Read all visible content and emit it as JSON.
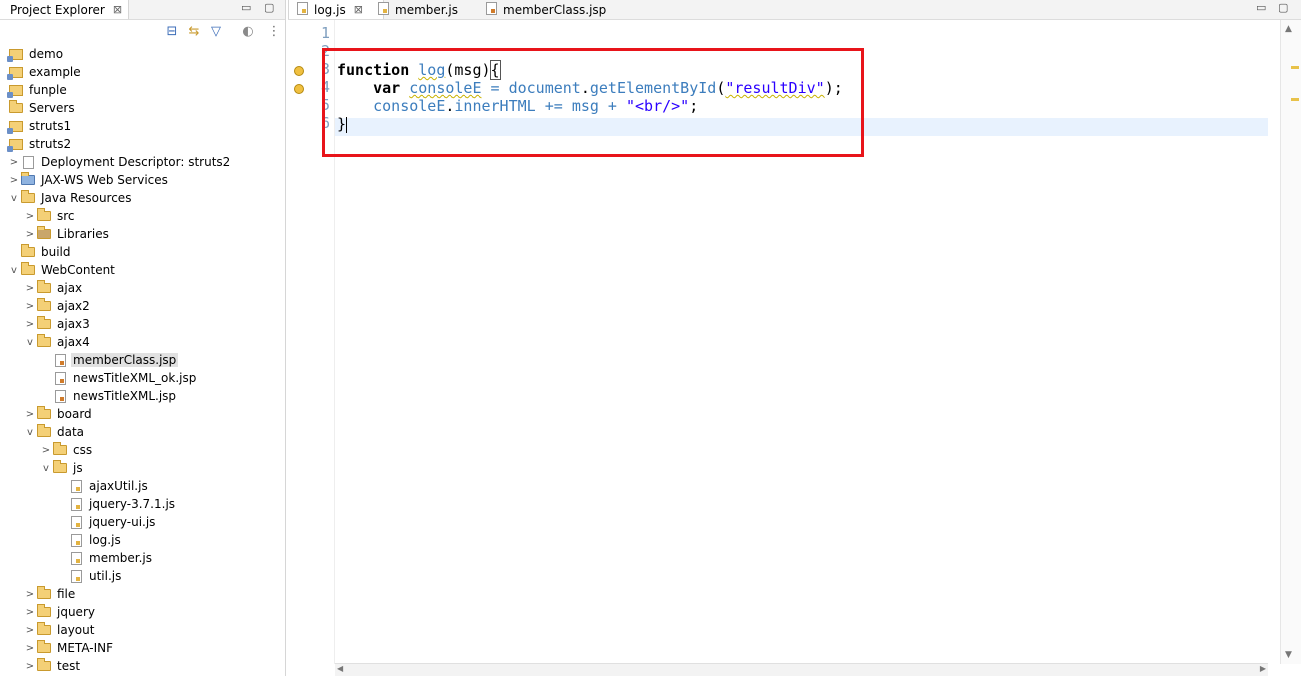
{
  "explorer": {
    "tab_label": "Project Explorer",
    "close_glyph": "⊠",
    "minimize_glyph": "▭",
    "maximize_glyph": "▢",
    "toolbar": [
      {
        "name": "collapse-all-icon",
        "glyph": "⊟"
      },
      {
        "name": "link-with-editor-icon",
        "glyph": "⇆"
      },
      {
        "name": "filter-icon",
        "glyph": "▽"
      },
      {
        "name": "working-sets-icon",
        "glyph": "◐"
      },
      {
        "name": "view-menu-icon",
        "glyph": "⋮"
      }
    ],
    "tree": [
      {
        "label": "demo",
        "level": 0,
        "kind": "project",
        "chev": ""
      },
      {
        "label": "example",
        "level": 0,
        "kind": "project",
        "chev": ""
      },
      {
        "label": "funple",
        "level": 0,
        "kind": "project",
        "chev": ""
      },
      {
        "label": "Servers",
        "level": 0,
        "kind": "folder",
        "chev": ""
      },
      {
        "label": "struts1",
        "level": 0,
        "kind": "project",
        "chev": ""
      },
      {
        "label": "struts2",
        "level": 0,
        "kind": "project",
        "chev": ""
      },
      {
        "label": "Deployment Descriptor: struts2",
        "level": 1,
        "kind": "descriptor",
        "chev": ">"
      },
      {
        "label": "JAX-WS Web Services",
        "level": 1,
        "kind": "webservice",
        "chev": ">"
      },
      {
        "label": "Java Resources",
        "level": 1,
        "kind": "javares",
        "chev": "v"
      },
      {
        "label": "src",
        "level": 2,
        "kind": "package",
        "chev": ">"
      },
      {
        "label": "Libraries",
        "level": 2,
        "kind": "library",
        "chev": ">"
      },
      {
        "label": "build",
        "level": 1,
        "kind": "folder",
        "chev": ""
      },
      {
        "label": "WebContent",
        "level": 1,
        "kind": "folder",
        "chev": "v"
      },
      {
        "label": "ajax",
        "level": 2,
        "kind": "folder",
        "chev": ">"
      },
      {
        "label": "ajax2",
        "level": 2,
        "kind": "folder",
        "chev": ">"
      },
      {
        "label": "ajax3",
        "level": 2,
        "kind": "folder",
        "chev": ">"
      },
      {
        "label": "ajax4",
        "level": 2,
        "kind": "folder",
        "chev": "v"
      },
      {
        "label": "memberClass.jsp",
        "level": 3,
        "kind": "jsp",
        "chev": "",
        "selected": true
      },
      {
        "label": "newsTitleXML_ok.jsp",
        "level": 3,
        "kind": "jsp",
        "chev": ""
      },
      {
        "label": "newsTitleXML.jsp",
        "level": 3,
        "kind": "jsp",
        "chev": ""
      },
      {
        "label": "board",
        "level": 2,
        "kind": "folder",
        "chev": ">"
      },
      {
        "label": "data",
        "level": 2,
        "kind": "folder",
        "chev": "v"
      },
      {
        "label": "css",
        "level": 3,
        "kind": "folder",
        "chev": ">"
      },
      {
        "label": "js",
        "level": 3,
        "kind": "folder",
        "chev": "v"
      },
      {
        "label": "ajaxUtil.js",
        "level": 4,
        "kind": "js",
        "chev": ""
      },
      {
        "label": "jquery-3.7.1.js",
        "level": 4,
        "kind": "js",
        "chev": ""
      },
      {
        "label": "jquery-ui.js",
        "level": 4,
        "kind": "js",
        "chev": ""
      },
      {
        "label": "log.js",
        "level": 4,
        "kind": "js",
        "chev": ""
      },
      {
        "label": "member.js",
        "level": 4,
        "kind": "js",
        "chev": ""
      },
      {
        "label": "util.js",
        "level": 4,
        "kind": "js",
        "chev": ""
      },
      {
        "label": "file",
        "level": 2,
        "kind": "folder",
        "chev": ">"
      },
      {
        "label": "jquery",
        "level": 2,
        "kind": "folder",
        "chev": ">"
      },
      {
        "label": "layout",
        "level": 2,
        "kind": "folder",
        "chev": ">"
      },
      {
        "label": "META-INF",
        "level": 2,
        "kind": "folder",
        "chev": ">"
      },
      {
        "label": "test",
        "level": 2,
        "kind": "folder",
        "chev": ">"
      }
    ]
  },
  "editor": {
    "tabs": [
      {
        "label": "log.js",
        "active": true,
        "closable": true
      },
      {
        "label": "member.js",
        "active": false,
        "closable": false
      },
      {
        "label": "memberClass.jsp",
        "active": false,
        "closable": false
      }
    ],
    "line_numbers": [
      "1",
      "2",
      "3",
      "4",
      "5",
      "6"
    ],
    "code": {
      "l3": {
        "kw": "function",
        "sp": " ",
        "fn": "log",
        "open": "(msg)",
        "brace": "{"
      },
      "l4": {
        "indent": "    ",
        "kw": "var",
        "sp": " ",
        "var": "consoleE",
        "eq": " = ",
        "obj": "document",
        "dot": ".",
        "method": "getElementById",
        "open": "(",
        "str": "\"resultDiv\"",
        "close": ");"
      },
      "l5": {
        "indent": "    ",
        "var": "consoleE",
        "dot": ".",
        "prop": "innerHTML",
        "op": " += ",
        "arg": "msg",
        "plus": " + ",
        "str": "\"<br/>\"",
        "semi": ";"
      },
      "l6": {
        "brace": "}"
      }
    },
    "scroll_up_glyph": "▲",
    "scroll_down_glyph": "▼",
    "scroll_left_glyph": "◀",
    "scroll_right_glyph": "▶"
  }
}
